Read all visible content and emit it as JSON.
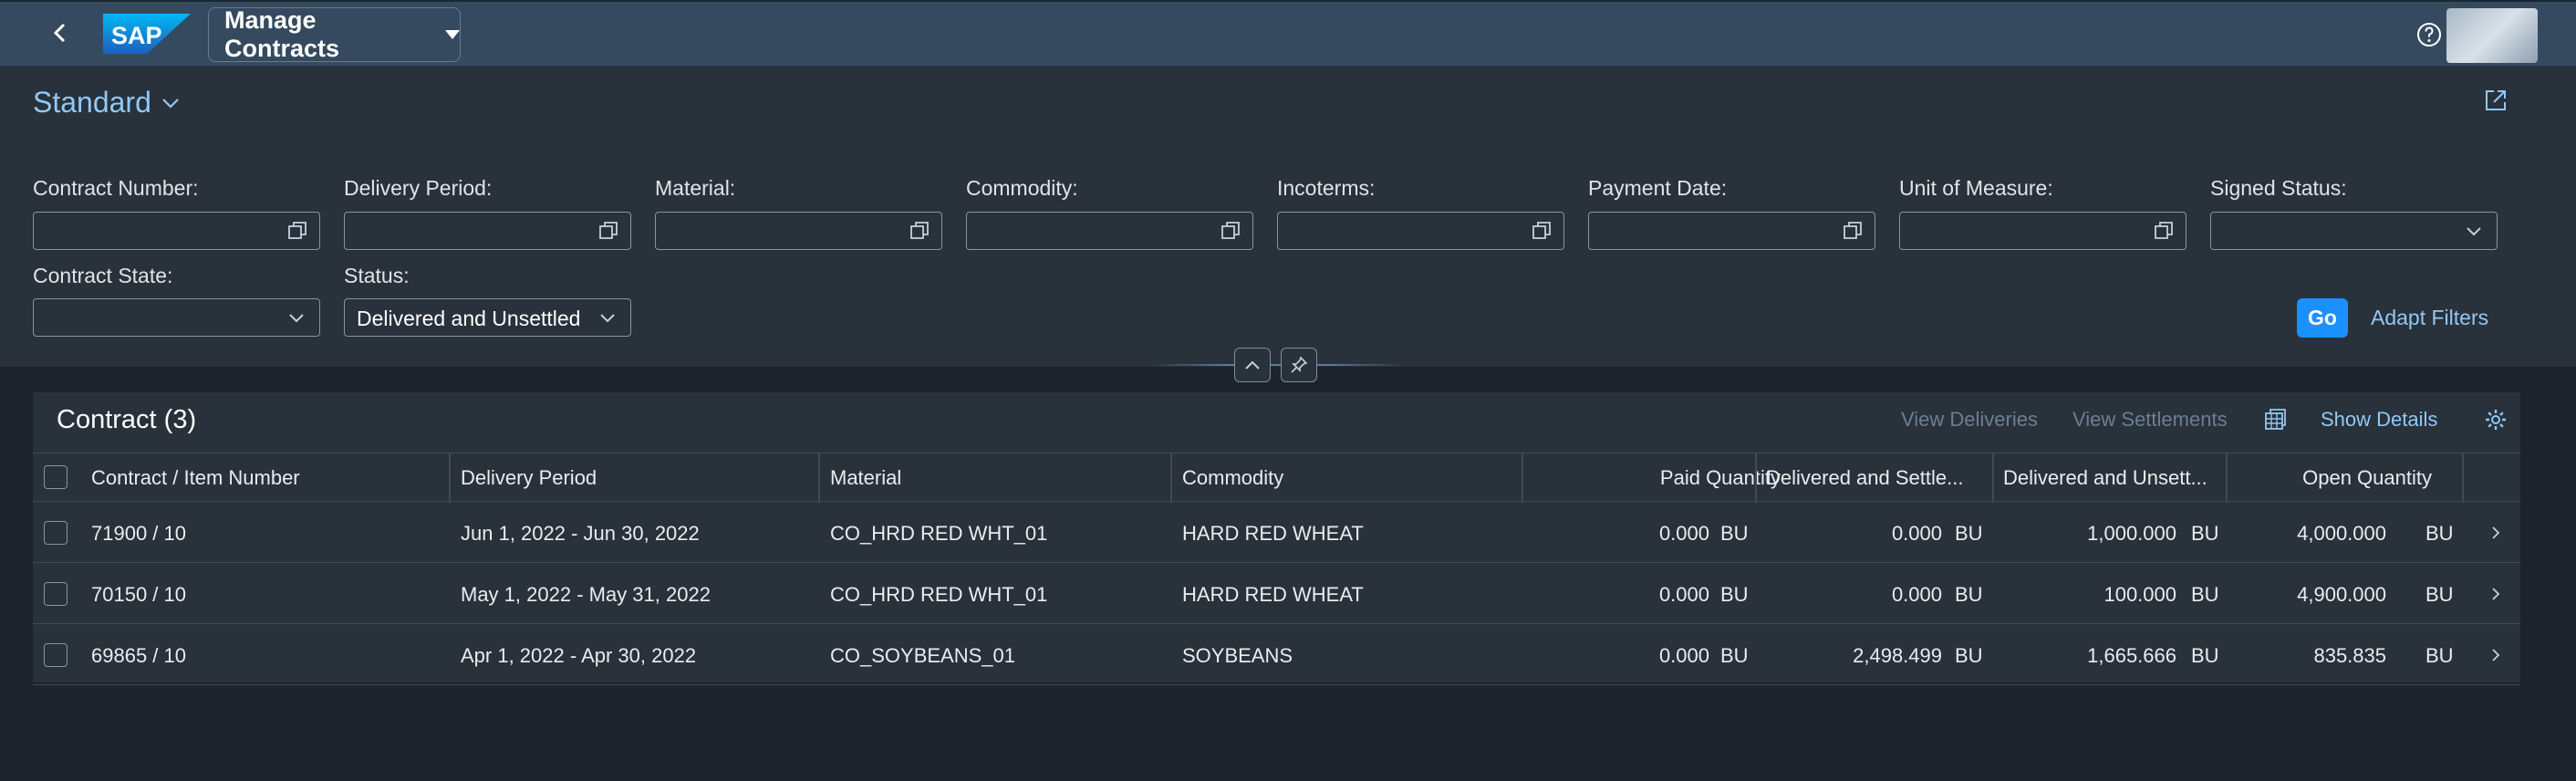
{
  "shell": {
    "app_title": "Manage Contracts",
    "logo_text": "SAP"
  },
  "filter": {
    "variant": "Standard",
    "fields": [
      {
        "label": "Contract Number:",
        "value": ""
      },
      {
        "label": "Delivery Period:",
        "value": ""
      },
      {
        "label": "Material:",
        "value": ""
      },
      {
        "label": "Commodity:",
        "value": ""
      },
      {
        "label": "Incoterms:",
        "value": ""
      },
      {
        "label": "Payment Date:",
        "value": ""
      },
      {
        "label": "Unit of Measure:",
        "value": ""
      },
      {
        "label": "Signed Status:",
        "value": ""
      },
      {
        "label": "Contract State:",
        "value": ""
      },
      {
        "label": "Status:",
        "value": "Delivered and Unsettled"
      }
    ],
    "go_label": "Go",
    "adapt_label": "Adapt Filters"
  },
  "table": {
    "title": "Contract (3)",
    "toolbar": {
      "view_deliveries": "View Deliveries",
      "view_settlements": "View Settlements",
      "show_details": "Show Details"
    },
    "columns": [
      "Contract / Item Number",
      "Delivery Period",
      "Material",
      "Commodity",
      "Paid Quantity",
      "Delivered and Settle...",
      "Delivered and Unsett...",
      "Open Quantity"
    ],
    "rows": [
      {
        "contract": "71900 / 10",
        "period": "Jun 1, 2022 - Jun 30, 2022",
        "material": "CO_HRD RED WHT_01",
        "commodity": "HARD RED WHEAT",
        "paid": "0.000",
        "paid_uom": "BU",
        "settled": "0.000",
        "settled_uom": "BU",
        "unsettled": "1,000.000",
        "unsettled_uom": "BU",
        "open": "4,000.000",
        "open_uom": "BU"
      },
      {
        "contract": "70150 / 10",
        "period": "May 1, 2022 - May 31, 2022",
        "material": "CO_HRD RED WHT_01",
        "commodity": "HARD RED WHEAT",
        "paid": "0.000",
        "paid_uom": "BU",
        "settled": "0.000",
        "settled_uom": "BU",
        "unsettled": "100.000",
        "unsettled_uom": "BU",
        "open": "4,900.000",
        "open_uom": "BU"
      },
      {
        "contract": "69865 / 10",
        "period": "Apr 1, 2022 - Apr 30, 2022",
        "material": "CO_SOYBEANS_01",
        "commodity": "SOYBEANS",
        "paid": "0.000",
        "paid_uom": "BU",
        "settled": "2,498.499",
        "settled_uom": "BU",
        "unsettled": "1,665.666",
        "unsettled_uom": "BU",
        "open": "835.835",
        "open_uom": "BU"
      }
    ]
  }
}
